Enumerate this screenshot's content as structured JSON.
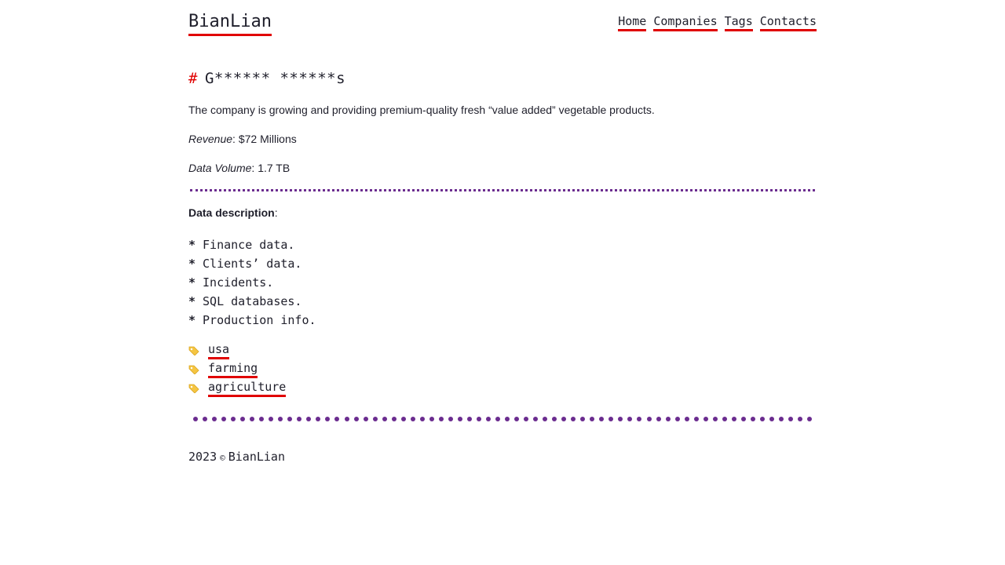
{
  "site": {
    "logo": "BianLian",
    "nav": [
      {
        "label": "Home"
      },
      {
        "label": "Companies"
      },
      {
        "label": "Tags"
      },
      {
        "label": "Contacts"
      }
    ]
  },
  "company": {
    "title_hash": "#",
    "title": "G****** ******s",
    "description": "The company is growing and providing premium-quality fresh “value added” vegetable products.",
    "revenue_label": "Revenue",
    "revenue_value": ": $72 Millions",
    "volume_label": "Data Volume",
    "volume_value": ": 1.7 TB",
    "data_description_label": "Data description",
    "data_description_colon": ":",
    "data_items": [
      "Finance data.",
      "Clients’ data.",
      "Incidents.",
      "SQL databases.",
      "Production info."
    ],
    "bullet": "*",
    "tags": [
      "usa",
      "farming",
      "agriculture"
    ]
  },
  "footer": {
    "year": "2023",
    "copyright": "©",
    "name": "BianLian"
  },
  "colors": {
    "accent": "#e00000",
    "divider": "#6b2c8f",
    "text": "#1f1f2b",
    "tag_icon": "#f5c542"
  },
  "icons": {
    "tag": "tag-icon"
  }
}
